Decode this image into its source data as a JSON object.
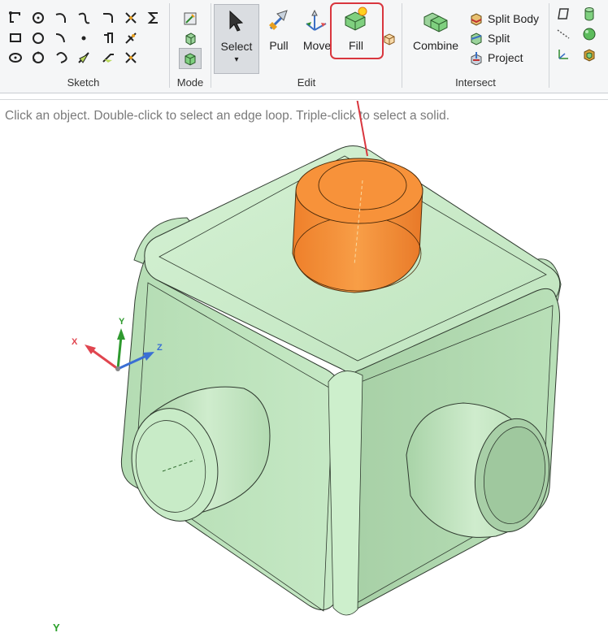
{
  "ribbon": {
    "groups": {
      "sketch": "Sketch",
      "mode": "Mode",
      "edit": "Edit",
      "intersect": "Intersect"
    },
    "edit": {
      "select": "Select",
      "pull": "Pull",
      "move": "Move",
      "fill": "Fill"
    },
    "intersect": {
      "combine": "Combine",
      "split_body": "Split Body",
      "split": "Split",
      "project": "Project"
    },
    "highlight_color": "#d9363e"
  },
  "hint": "Click an object. Double-click to select an edge loop. Triple-click to select a solid.",
  "triad": {
    "x": "X",
    "y": "Y",
    "z": "Z"
  },
  "view_axis_label": "Y",
  "colors": {
    "model_green": "#c8ecc8",
    "selection_orange": "#f5842a",
    "arrow_red": "#d9363e"
  }
}
